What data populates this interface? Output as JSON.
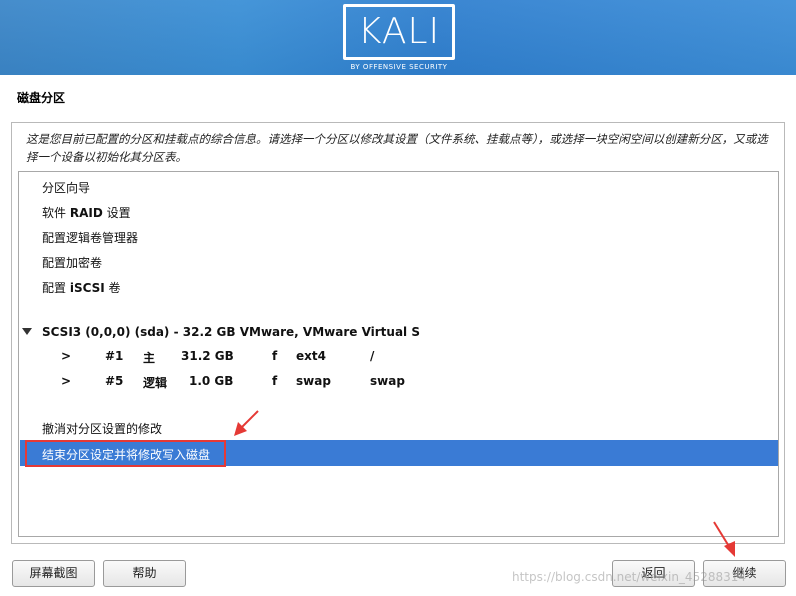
{
  "header": {
    "logo_text": "KALI",
    "logo_subtitle": "BY OFFENSIVE SECURITY"
  },
  "page": {
    "title": "磁盘分区",
    "description": "这是您目前已配置的分区和挂载点的综合信息。请选择一个分区以修改其设置（文件系统、挂载点等），或选择一块空闲空间以创建新分区，又或选择一个设备以初始化其分区表。"
  },
  "menu": {
    "items": [
      {
        "label": "分区向导"
      },
      {
        "label_prefix": "软件 ",
        "label_bold": "RAID",
        "label_suffix": " 设置"
      },
      {
        "label": "配置逻辑卷管理器"
      },
      {
        "label": "配置加密卷"
      },
      {
        "label_prefix": "配置 ",
        "label_bold": "iSCSI",
        "label_suffix": " 卷"
      }
    ],
    "disk": "SCSI3 (0,0,0) (sda) - 32.2 GB VMware, VMware Virtual S",
    "partitions": [
      {
        "arrow": ">",
        "num": "#1",
        "type": "主",
        "size": "31.2 GB",
        "flag": "f",
        "fs": "ext4",
        "mount": "/"
      },
      {
        "arrow": ">",
        "num": "#5",
        "type": "逻辑",
        "size": "1.0 GB",
        "flag": "f",
        "fs": "swap",
        "mount": "swap"
      }
    ],
    "undo": "撤消对分区设置的修改",
    "finish": "结束分区设定并将修改写入磁盘"
  },
  "buttons": {
    "screenshot": "屏幕截图",
    "help": "帮助",
    "back": "返回",
    "continue": "继续"
  },
  "watermark": "https://blog.csdn.net/weixin_45288314",
  "colors": {
    "banner": "#3a8fd6",
    "selection": "#3a7bd5",
    "annotation": "#e53935"
  }
}
